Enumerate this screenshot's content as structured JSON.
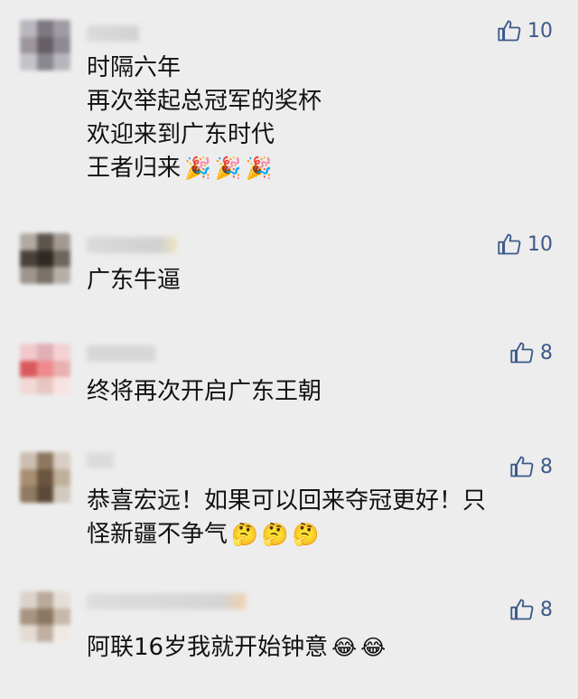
{
  "comments": [
    {
      "lines": [
        "时隔六年",
        "再次举起总冠军的奖杯",
        "欢迎来到广东时代",
        "王者归来"
      ],
      "emoji": [
        "🎉",
        "🎉",
        "🎉"
      ],
      "likes": "10"
    },
    {
      "lines": [
        "广东牛逼"
      ],
      "emoji": [],
      "likes": "10"
    },
    {
      "lines": [
        "终将再次开启广东王朝"
      ],
      "emoji": [],
      "likes": "8"
    },
    {
      "lines": [
        "恭喜宏远！如果可以回来夺冠更好！只",
        "怪新疆不争气"
      ],
      "emoji": [
        "🤔",
        "🤔",
        "🤔"
      ],
      "likes": "8"
    },
    {
      "lines": [
        "阿联16岁我就开始钟意"
      ],
      "emoji": [
        "😂",
        "😂"
      ],
      "likes": "8"
    }
  ],
  "icons": {
    "like": "thumbs-up-icon"
  },
  "colors": {
    "like": "#3d5a8a",
    "background": "#ededed",
    "text": "#111111"
  }
}
